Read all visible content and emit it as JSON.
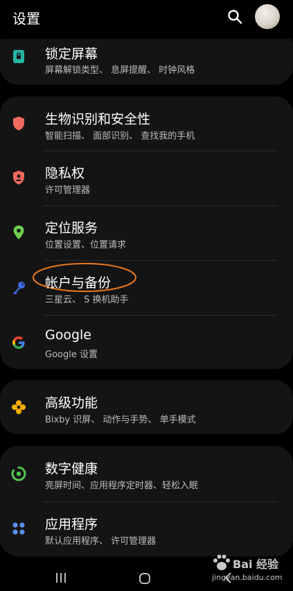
{
  "header": {
    "title": "设置"
  },
  "items": {
    "lock_screen": {
      "title": "锁定屏幕",
      "subtitle": "屏幕解锁类型、 息屏提醒、 时钟风格"
    },
    "biometrics": {
      "title": "生物识别和安全性",
      "subtitle": "智能扫描、 面部识别、 查找我的手机"
    },
    "privacy": {
      "title": "隐私权",
      "subtitle": "许可管理器"
    },
    "location": {
      "title": "定位服务",
      "subtitle": "位置设置、位置请求"
    },
    "accounts": {
      "title": "帐户与备份",
      "subtitle": "三星云、 S 换机助手"
    },
    "google": {
      "title": "Google",
      "subtitle": "Google 设置"
    },
    "advanced": {
      "title": "高级功能",
      "subtitle": "Bixby 识屏、 动作与手势、 单手模式"
    },
    "wellbeing": {
      "title": "数字健康",
      "subtitle": "亮屏时间、应用程序定时器、轻松入眠"
    },
    "apps": {
      "title": "应用程序",
      "subtitle": "默认应用程序、 许可管理器"
    }
  },
  "watermark": {
    "main": "Bai 经验",
    "sub": "jingyan.baidu.com"
  },
  "colors": {
    "lock": "#24b3a0",
    "shield": "#f06a5f",
    "privacy": "#f06a5f",
    "location": "#6fce4f",
    "key": "#3d6de8",
    "advanced": "#f7b000",
    "wellbeing": "#53c653",
    "apps": "#5d8ff2",
    "highlight_ellipse": "#e8791f"
  }
}
